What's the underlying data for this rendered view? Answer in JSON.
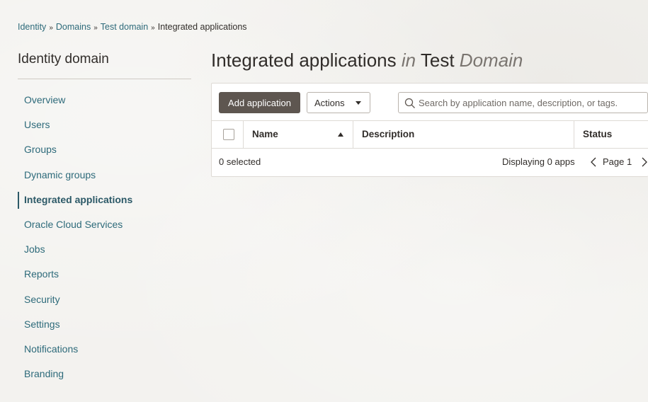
{
  "breadcrumb": {
    "items": [
      "Identity",
      "Domains",
      "Test domain"
    ],
    "current": "Integrated applications",
    "separator": "»"
  },
  "sidebar": {
    "title": "Identity domain",
    "items": [
      {
        "label": "Overview"
      },
      {
        "label": "Users"
      },
      {
        "label": "Groups"
      },
      {
        "label": "Dynamic groups"
      },
      {
        "label": "Integrated applications",
        "active": true
      },
      {
        "label": "Oracle Cloud Services"
      },
      {
        "label": "Jobs"
      },
      {
        "label": "Reports"
      },
      {
        "label": "Security"
      },
      {
        "label": "Settings"
      },
      {
        "label": "Notifications"
      },
      {
        "label": "Branding"
      }
    ]
  },
  "page": {
    "title_main": "Integrated applications",
    "title_in": "in",
    "title_domain": "Test",
    "title_domain_em": "Domain"
  },
  "toolbar": {
    "add_label": "Add application",
    "actions_label": "Actions",
    "search_placeholder": "Search by application name, description, or tags."
  },
  "table": {
    "columns": [
      "Name",
      "Description",
      "Status"
    ],
    "sort_column": "Name",
    "sort_direction": "ascending",
    "rows": []
  },
  "footer": {
    "selected": "0 selected",
    "display": "Displaying 0 apps",
    "page": "Page 1"
  },
  "icons": {
    "search": "search-icon",
    "sort": "sort-ascending-icon",
    "prev": "chevron-left-icon",
    "next": "chevron-right-icon",
    "caret": "caret-down-icon"
  },
  "colors": {
    "link": "#2d6a7a",
    "primary_button": "#5e5650",
    "background": "#f3f2ef"
  }
}
